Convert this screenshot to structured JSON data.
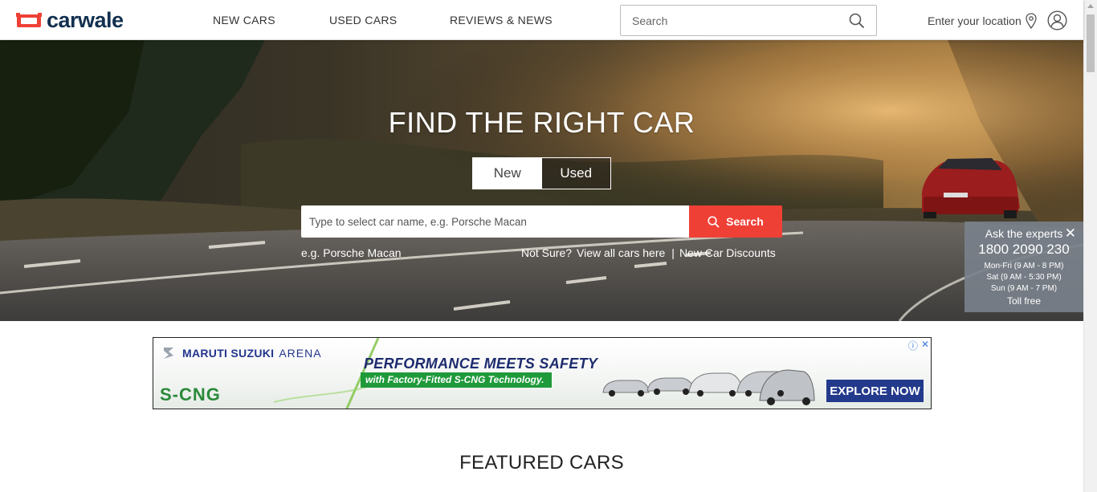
{
  "header": {
    "logo_text": "carwale",
    "nav": [
      "NEW CARS",
      "USED CARS",
      "REVIEWS & NEWS"
    ],
    "search_placeholder": "Search",
    "location_label": "Enter your location",
    "colors": {
      "brand_red": "#ef4036",
      "brand_navy": "#12304f"
    }
  },
  "hero": {
    "title": "FIND THE RIGHT CAR",
    "tabs": [
      {
        "label": "New",
        "active": true
      },
      {
        "label": "Used",
        "active": false
      }
    ],
    "search_placeholder": "Type to select car name, e.g. Porsche Macan",
    "search_button": "Search",
    "example_text": "e.g. Porsche Macan",
    "not_sure": "Not Sure?",
    "view_all_link": "View all cars here",
    "separator": "|",
    "discounts_link": "New Car Discounts"
  },
  "experts": {
    "title": "Ask the experts",
    "close": "✕",
    "phone": "1800 2090 230",
    "hours": [
      "Mon-Fri (9 AM - 8 PM)",
      "Sat (9 AM - 5:30 PM)",
      "Sun (9 AM - 7 PM)"
    ],
    "toll": "Toll free"
  },
  "ad": {
    "brand": "MARUTI SUZUKI",
    "brand_sub": "ARENA",
    "cng": "S-CNG",
    "headline": "PERFORMANCE MEETS SAFETY",
    "subline": "with Factory-Fitted S-CNG Technology.",
    "cta": "EXPLORE NOW",
    "adchoices_icon": "ⓘ",
    "adchoices_close": "✕"
  },
  "sections": {
    "featured_title": "FEATURED CARS"
  }
}
